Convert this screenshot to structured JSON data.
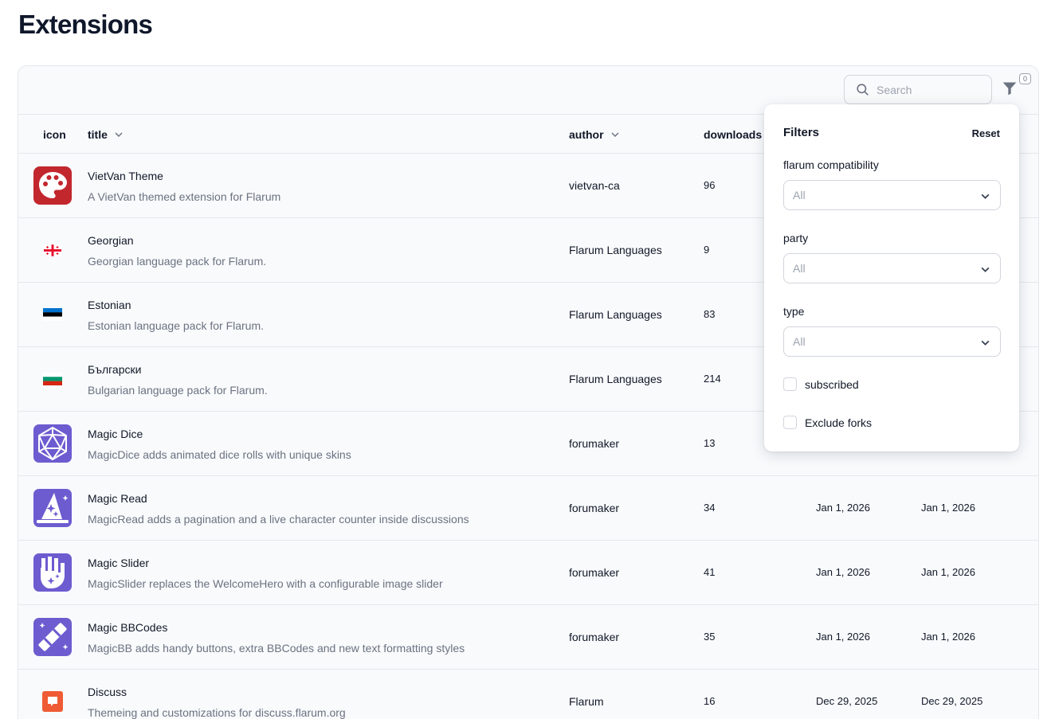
{
  "page": {
    "title": "Extensions"
  },
  "toolbar": {
    "search_placeholder": "Search",
    "filter_count": "0",
    "search_icon": "search-icon",
    "filter_icon": "funnel-icon"
  },
  "table": {
    "columns": [
      {
        "label": "icon",
        "sortable": false
      },
      {
        "label": "title",
        "sortable": true
      },
      {
        "label": "author",
        "sortable": true
      },
      {
        "label": "downloads",
        "sortable": true
      }
    ],
    "rows": [
      {
        "icon": "palette-icon",
        "title": "VietVan Theme",
        "description": "A VietVan themed extension for Flarum",
        "author": "vietvan-ca",
        "downloads": "96",
        "date1": "",
        "date2": ""
      },
      {
        "icon": "georgia-flag-icon",
        "title": "Georgian",
        "description": "Georgian language pack for Flarum.",
        "author": "Flarum Languages",
        "downloads": "9",
        "date1": "",
        "date2": ""
      },
      {
        "icon": "estonia-flag-icon",
        "title": "Estonian",
        "description": "Estonian language pack for Flarum.",
        "author": "Flarum Languages",
        "downloads": "83",
        "date1": "",
        "date2": ""
      },
      {
        "icon": "bulgaria-flag-icon",
        "title": "Български",
        "description": "Bulgarian language pack for Flarum.",
        "author": "Flarum Languages",
        "downloads": "214",
        "date1": "",
        "date2": ""
      },
      {
        "icon": "d20-dice-icon",
        "title": "Magic Dice",
        "description": "MagicDice adds animated dice rolls with unique skins",
        "author": "forumaker",
        "downloads": "13",
        "date1": "",
        "date2": ""
      },
      {
        "icon": "wizard-hat-icon",
        "title": "Magic Read",
        "description": "MagicRead adds a pagination and a live character counter inside discussions",
        "author": "forumaker",
        "downloads": "34",
        "date1": "Jan 1, 2026",
        "date2": "Jan 1, 2026"
      },
      {
        "icon": "magic-hand-icon",
        "title": "Magic Slider",
        "description": "MagicSlider replaces the WelcomeHero with a configurable image slider",
        "author": "forumaker",
        "downloads": "41",
        "date1": "Jan 1, 2026",
        "date2": "Jan 1, 2026"
      },
      {
        "icon": "magic-wand-icon",
        "title": "Magic BBCodes",
        "description": "MagicBB adds handy buttons, extra BBCodes and new text formatting styles",
        "author": "forumaker",
        "downloads": "35",
        "date1": "Jan 1, 2026",
        "date2": "Jan 1, 2026"
      },
      {
        "icon": "speech-bubble-icon",
        "title": "Discuss",
        "description": "Themeing and customizations for discuss.flarum.org",
        "author": "Flarum",
        "downloads": "16",
        "date1": "Dec 29, 2025",
        "date2": "Dec 29, 2025"
      }
    ]
  },
  "filters": {
    "title": "Filters",
    "reset": "Reset",
    "compat_label": "flarum compatibility",
    "compat_value": "All",
    "party_label": "party",
    "party_value": "All",
    "type_label": "type",
    "type_value": "All",
    "subscribed_label": "subscribed",
    "exclude_forks_label": "Exclude forks"
  },
  "colors": {
    "magic_purple": "#6d5bd0",
    "vietvan_red": "#c1272d",
    "discuss_orange": "#ef5b34"
  }
}
